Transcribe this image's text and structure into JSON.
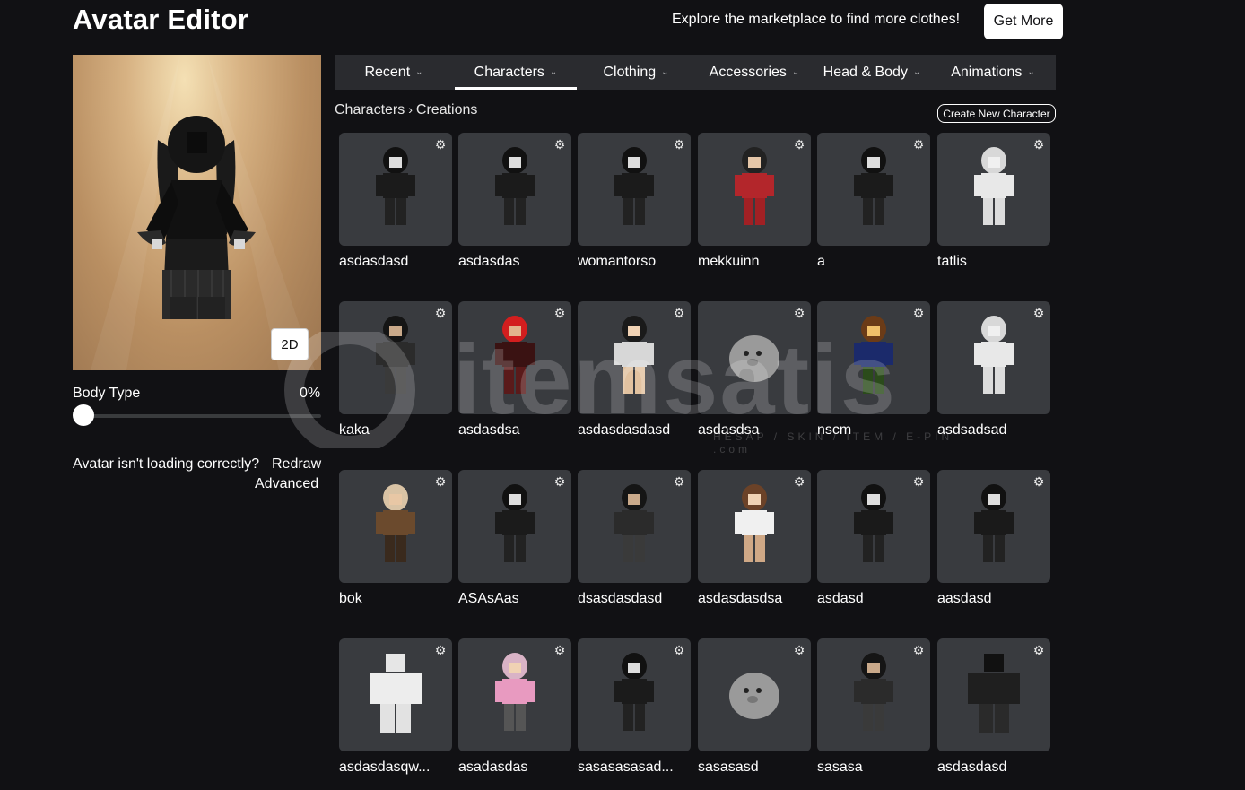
{
  "header": {
    "title": "Avatar Editor",
    "promo_text": "Explore the marketplace to find more clothes!",
    "get_more_label": "Get More"
  },
  "preview": {
    "view_toggle_label": "2D",
    "body_type_label": "Body Type",
    "body_type_value": "0%",
    "body_type_level": 0,
    "loading_question": "Avatar isn't loading correctly?",
    "redraw_label": "Redraw",
    "advanced_label": "Advanced"
  },
  "tabs": [
    {
      "label": "Recent",
      "active": false
    },
    {
      "label": "Characters",
      "active": true
    },
    {
      "label": "Clothing",
      "active": false
    },
    {
      "label": "Accessories",
      "active": false
    },
    {
      "label": "Head & Body",
      "active": false
    },
    {
      "label": "Animations",
      "active": false
    }
  ],
  "breadcrumb": {
    "root": "Characters",
    "current": "Creations"
  },
  "create_new_label": "Create New Character",
  "characters": [
    {
      "name": "asdasdasd",
      "figure": "dark-dress"
    },
    {
      "name": "asdasdas",
      "figure": "dark-dress"
    },
    {
      "name": "womantorso",
      "figure": "dark-dress"
    },
    {
      "name": "mekkuinn",
      "figure": "red-outfit"
    },
    {
      "name": "a",
      "figure": "dark-dress"
    },
    {
      "name": "tatlis",
      "figure": "white-outfit"
    },
    {
      "name": "kaka",
      "figure": "dark-outfit"
    },
    {
      "name": "asdasdsa",
      "figure": "red-hat"
    },
    {
      "name": "asdasdasdasd",
      "figure": "cat-ears"
    },
    {
      "name": "asdasdsa",
      "figure": "seal"
    },
    {
      "name": "nscm",
      "figure": "classic"
    },
    {
      "name": "asdsadsad",
      "figure": "white-outfit"
    },
    {
      "name": "bok",
      "figure": "tan-outfit"
    },
    {
      "name": "ASAsAas",
      "figure": "dark-dress"
    },
    {
      "name": "dsasdasdasd",
      "figure": "dark-outfit"
    },
    {
      "name": "asdasdasdsa",
      "figure": "brown-hair"
    },
    {
      "name": "asdasd",
      "figure": "bear-hood"
    },
    {
      "name": "aasdasd",
      "figure": "bear-hood"
    },
    {
      "name": "asdasdasqw...",
      "figure": "white-block"
    },
    {
      "name": "asadasdas",
      "figure": "pink-outfit"
    },
    {
      "name": "sasasasasad...",
      "figure": "dark-dress"
    },
    {
      "name": "sasasasd",
      "figure": "seal"
    },
    {
      "name": "sasasa",
      "figure": "dark-outfit"
    },
    {
      "name": "asdasdasd",
      "figure": "dark-block"
    }
  ],
  "watermark": {
    "text": "itemsatis",
    "sub": "HESAP / SKIN / ITEM / E-PIN .com"
  },
  "colors": {
    "background": "#111114",
    "card": "#393b3f",
    "tab_bar": "#2a2b2f",
    "button": "#ffffff"
  }
}
